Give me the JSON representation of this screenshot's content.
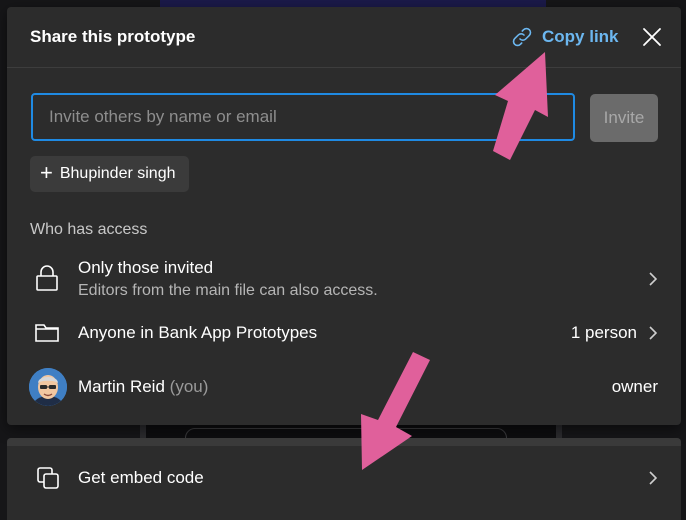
{
  "dialog": {
    "title": "Share this prototype",
    "copy_link_label": "Copy link",
    "invite": {
      "placeholder": "Invite others by name or email",
      "value": "",
      "button_label": "Invite"
    },
    "suggestion_chip": "Bhupinder singh",
    "access_section_label": "Who has access",
    "access_rows": [
      {
        "icon": "lock-icon",
        "title": "Only those invited",
        "subtitle": "Editors from the main file can also access."
      },
      {
        "icon": "folder-icon",
        "title": "Anyone in Bank App Prototypes",
        "meta": "1 person"
      },
      {
        "icon": "avatar",
        "title": "Martin Reid",
        "title_suffix": "(you)",
        "meta": "owner"
      }
    ]
  },
  "embed": {
    "label": "Get embed code",
    "icon": "copy-icon"
  },
  "colors": {
    "dialog_bg": "#2c2c2c",
    "accent_blue": "#1f8ae3",
    "link_blue": "#6cb7f0",
    "annotation_arrow": "#e0609b",
    "disabled_button": "#6b6b6b"
  }
}
